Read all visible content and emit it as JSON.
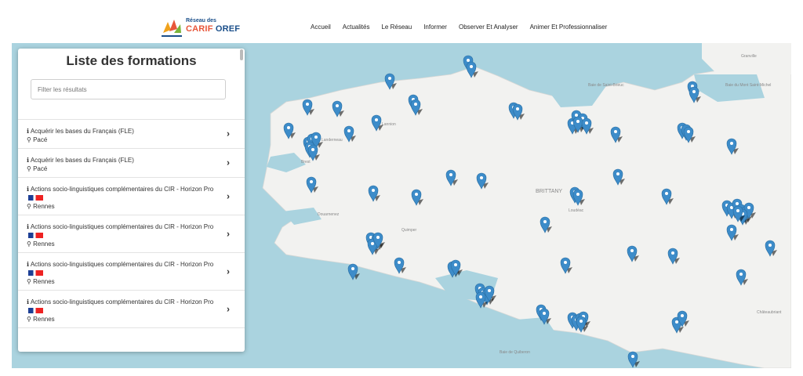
{
  "header": {
    "logo_small": "Réseau des",
    "logo_carif": "CARIF",
    "logo_oref": "OREF",
    "nav": [
      "Accueil",
      "Actualités",
      "Le Réseau",
      "Informer",
      "Observer Et Analyser",
      "Animer Et Professionnaliser"
    ]
  },
  "panel": {
    "title": "Liste des formations",
    "filter_placeholder": "Filter les résultats"
  },
  "list": [
    {
      "title": "Acquérir les bases du Français (FLE)",
      "place": "Pacé",
      "flag": false
    },
    {
      "title": "Acquérir les bases du Français (FLE)",
      "place": "Pacé",
      "flag": false
    },
    {
      "title": "Actions socio-linguistiques complémentaires du CIR - Horizon Pro",
      "place": "Rennes",
      "flag": true
    },
    {
      "title": "Actions socio-linguistiques complémentaires du CIR - Horizon Pro",
      "place": "Rennes",
      "flag": true
    },
    {
      "title": "Actions socio-linguistiques complémentaires du CIR - Horizon Pro",
      "place": "Rennes",
      "flag": true
    },
    {
      "title": "Actions socio-linguistiques complémentaires du CIR - Horizon Pro",
      "place": "Rennes",
      "flag": true
    }
  ],
  "map": {
    "labels": [
      "BRITTANY",
      "Brest",
      "Lannion",
      "Granville",
      "Landerneau",
      "Quimper",
      "Douarnenez",
      "Loudéac",
      "Châteaubriant",
      "Baie de Saint-Brieuc",
      "Baie du Mont Saint-Michel",
      "Baie de Quiberon"
    ],
    "pin_color": "#3d8cc9",
    "land_color": "#f2f2f0",
    "sea_color": "#aad3df"
  }
}
